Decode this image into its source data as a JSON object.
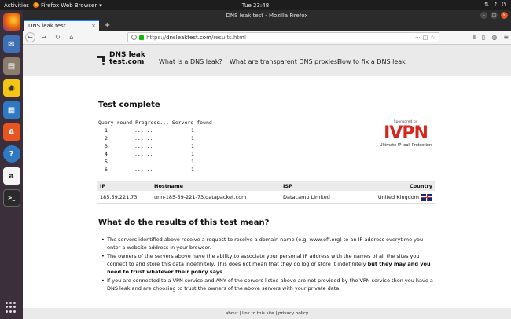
{
  "desktop": {
    "activities": "Activities",
    "app_name": "Firefox Web Browser",
    "clock": "Tue 23:48",
    "tray": [
      "⇅",
      "♪",
      "⏻"
    ]
  },
  "browser": {
    "window_title": "DNS leak test - Mozilla Firefox",
    "tab_title": "DNS leak test",
    "url_scheme": "https://",
    "url_host": "dnsleaktest.com",
    "url_path": "/results.html"
  },
  "site": {
    "logo_line1": "DNS leak",
    "logo_line2": "test.com",
    "nav": [
      "What is a DNS leak?",
      "What are transparent DNS proxies?",
      "How to fix a DNS leak"
    ]
  },
  "test": {
    "heading": "Test complete",
    "query_header": "Query round Progress... Servers found",
    "rounds": [
      {
        "round": "1",
        "progress": "......",
        "found": "1"
      },
      {
        "round": "2",
        "progress": "......",
        "found": "1"
      },
      {
        "round": "3",
        "progress": "......",
        "found": "1"
      },
      {
        "round": "4",
        "progress": "......",
        "found": "1"
      },
      {
        "round": "5",
        "progress": "......",
        "found": "1"
      },
      {
        "round": "6",
        "progress": "......",
        "found": "1"
      }
    ]
  },
  "sponsor": {
    "label": "Sponsored by",
    "brand": "IVPN",
    "tagline": "Ultimate IP leak Protection"
  },
  "results": {
    "headers": {
      "ip": "IP",
      "hostname": "Hostname",
      "isp": "ISP",
      "country": "Country"
    },
    "rows": [
      {
        "ip": "185.59.221.73",
        "hostname": "unn-185-59-221-73.datapacket.com",
        "isp": "Datacamp Limited",
        "country": "United Kingdom"
      }
    ]
  },
  "explain": {
    "heading": "What do the results of this test mean?",
    "b1": "The servers identified above receive a request to resolve a domain name (e.g. www.eff.org) to an IP address everytime you enter a website address in your browser.",
    "b2_a": "The owners of the servers above have the ability to associate your personal IP address with the names of all the sites you connect to and store this data indefinitely. This does not mean that they do log or store it indefinitely ",
    "b2_b": "but they may and you need to trust whatever their policy says",
    "b2_c": ".",
    "b3": "If you are connected to a VPN service and ANY of the servers listed above are not provided by the VPN service then you have a DNS leak and are choosing to trust the owners of the above servers with your private data."
  },
  "footer": {
    "about": "about",
    "sep1": " | ",
    "link": "link to this site",
    "sep2": " | ",
    "privacy": "privacy policy"
  }
}
